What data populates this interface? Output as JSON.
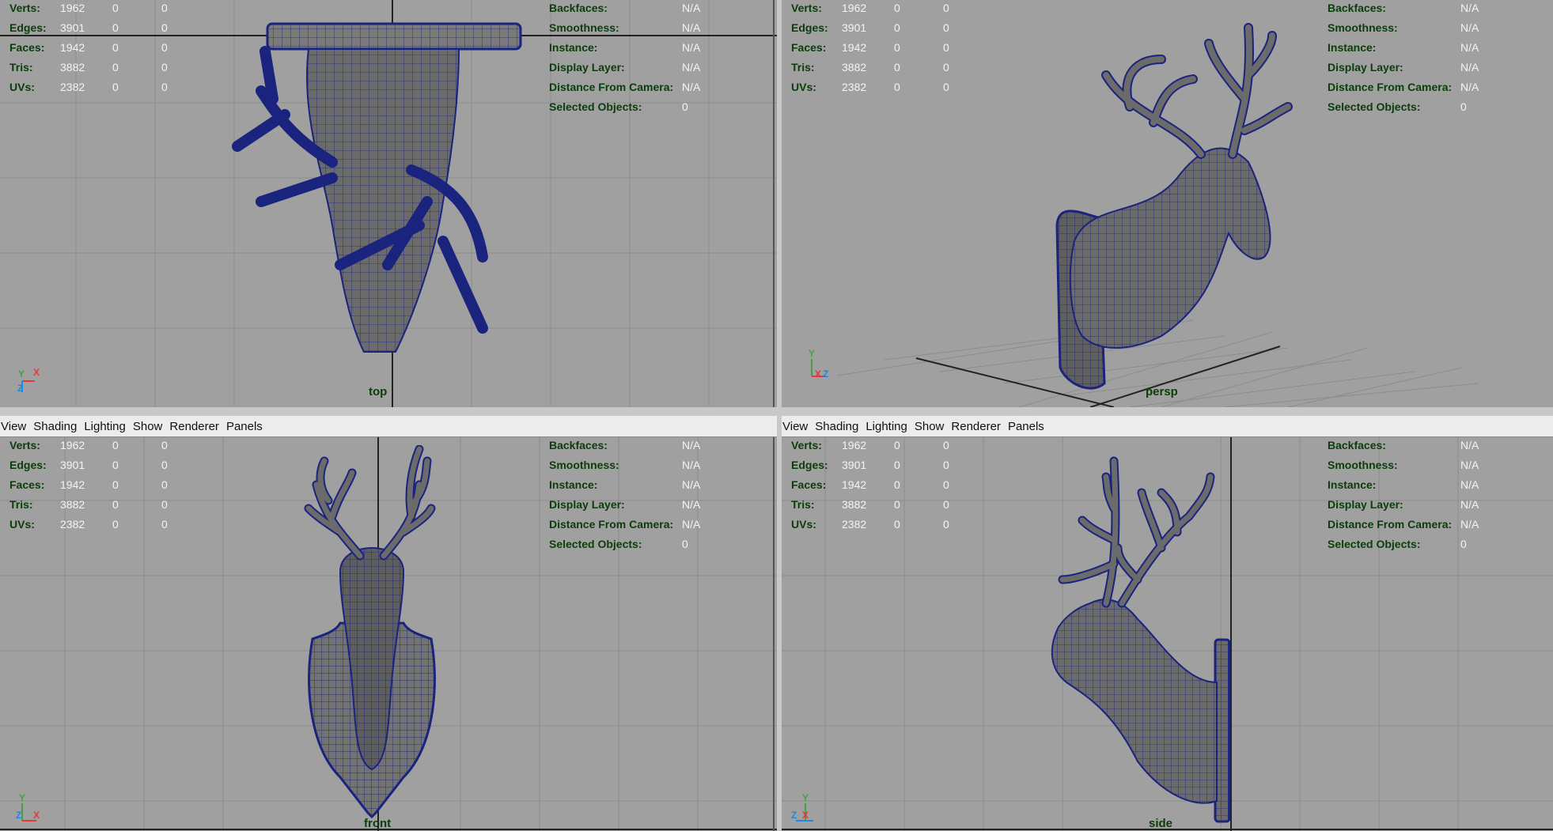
{
  "menu": [
    "View",
    "Shading",
    "Lighting",
    "Show",
    "Renderer",
    "Panels"
  ],
  "hud_left": [
    {
      "label": "Verts:",
      "values": [
        "1962",
        "0",
        "0"
      ]
    },
    {
      "label": "Edges:",
      "values": [
        "3901",
        "0",
        "0"
      ]
    },
    {
      "label": "Faces:",
      "values": [
        "1942",
        "0",
        "0"
      ]
    },
    {
      "label": "Tris:",
      "values": [
        "3882",
        "0",
        "0"
      ]
    },
    {
      "label": "UVs:",
      "values": [
        "2382",
        "0",
        "0"
      ]
    }
  ],
  "hud_right": [
    {
      "label": "Backfaces:",
      "value": "N/A"
    },
    {
      "label": "Smoothness:",
      "value": "N/A"
    },
    {
      "label": "Instance:",
      "value": "N/A"
    },
    {
      "label": "Display Layer:",
      "value": "N/A"
    },
    {
      "label": "Distance From Camera:",
      "value": "N/A"
    },
    {
      "label": "Selected Objects:",
      "value": "0"
    }
  ],
  "panels": {
    "top": {
      "camera": "top",
      "axis_a": "Y",
      "axis_b": "X",
      "axis_c": "Z"
    },
    "persp": {
      "camera": "persp",
      "axis_a": "Y",
      "axis_b": "X",
      "axis_c": "Z"
    },
    "front": {
      "camera": "front",
      "axis_a": "Y",
      "axis_b": "X",
      "axis_c": "Z"
    },
    "side": {
      "camera": "side",
      "axis_a": "Y",
      "axis_b": "X",
      "axis_c": "Z"
    }
  },
  "colors": {
    "viewport_bg": "#a0a0a0",
    "grid": "#8c8c8c",
    "wire": "#1a237e",
    "hud_label": "#0b3d0b",
    "hud_value": "#f4f4f4"
  }
}
